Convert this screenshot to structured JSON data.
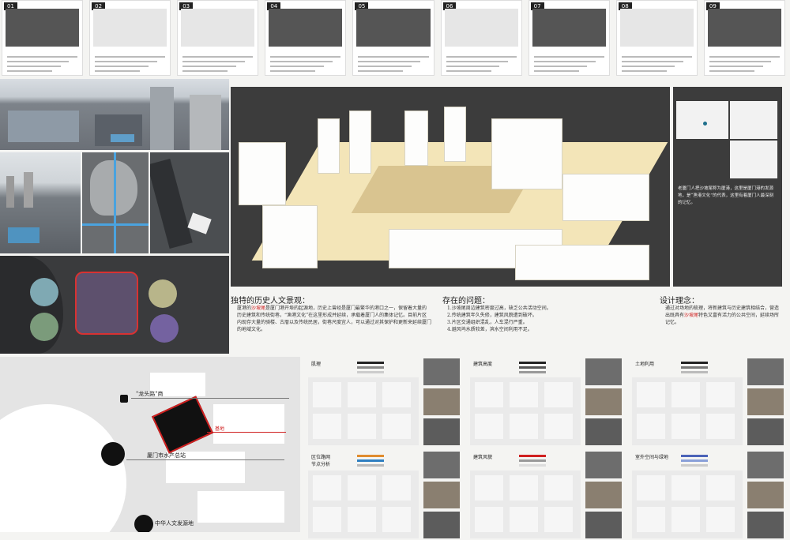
{
  "top_cards": [
    {
      "number": "01",
      "tone": "dark"
    },
    {
      "number": "02",
      "tone": "light"
    },
    {
      "number": "03",
      "tone": "light"
    },
    {
      "number": "04",
      "tone": "dark"
    },
    {
      "number": "05",
      "tone": "dark"
    },
    {
      "number": "06",
      "tone": "light"
    },
    {
      "number": "07",
      "tone": "dark"
    },
    {
      "number": "08",
      "tone": "light"
    },
    {
      "number": "09",
      "tone": "dark"
    }
  ],
  "map_labels": {
    "label_1": "\"龙头路\"商",
    "label_2": "厦门市水产总站",
    "label_3": "中华人文发源地",
    "label_red": "基地"
  },
  "sections": {
    "history_title": "独特的历史人文景观：",
    "history_text_pre": "厦港的",
    "history_text_hl": "沙坡尾",
    "history_text_post": "是厦门港开埠的起源地，历史上曾经是厦门最繁华的港口之一，保留着大量的历史建筑和传统街巷，“渔港文化”在这里形成并延续，承载着厦门人的集体记忆。目前片区内现存大量的骑楼、古厝以及传统民居，街巷尺度宜人，可以通过对其保护和更新来延续厦门的地域文化。",
    "problems_title": "存在的问题：",
    "problems_items": [
      "1.沙坡尾周边建筑密度过高，缺乏公共活动空间。",
      "2.传统建筑年久失修，建筑风貌遭到破坏。",
      "3.片区交通组织混乱，人车混行严重。",
      "4.避风坞水质较差，滨水空间利用不足。"
    ],
    "concept_title": "设计理念：",
    "concept_text_pre": "通过对场地的梳理，将新建筑与历史建筑相结合，营造出既具有",
    "concept_text_hl": "沙坡尾",
    "concept_text_post": "特色又富有活力的公共空间，延续场所记忆。"
  },
  "location_text": "老厦门人把沙坡尾称为厦港，这里是厦门港的发源地，是“渔港文化”的代表，这里有着厦门人最深刻的记忆。",
  "analysis_panels": [
    {
      "title": "肌理"
    },
    {
      "title": "建筑高度"
    },
    {
      "title": "土地利用"
    },
    {
      "title": "区位路网\n节点分析"
    },
    {
      "title": "建筑风貌"
    },
    {
      "title": "室外空间与绿地"
    }
  ],
  "colors": {
    "accent_red": "#d02020",
    "model_base": "#f3e5b8",
    "dark_bg": "#3c3c3c"
  }
}
